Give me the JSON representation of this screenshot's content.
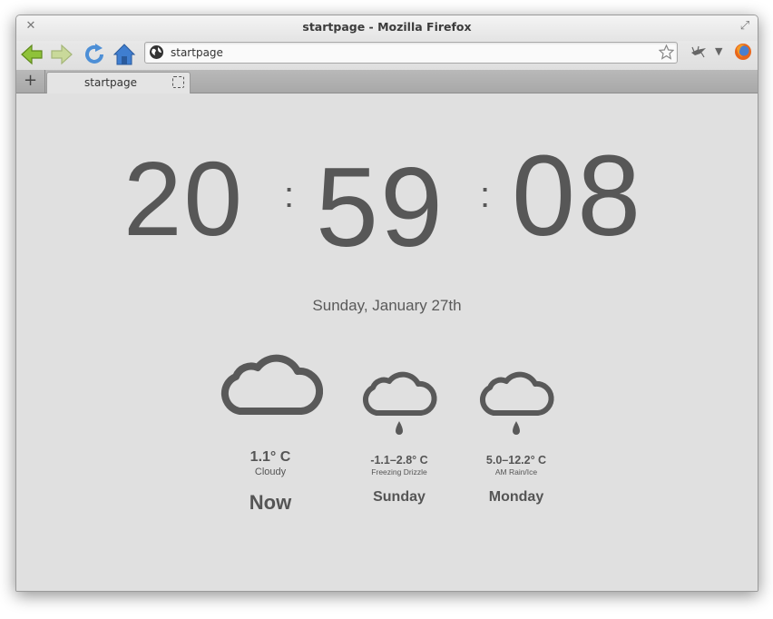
{
  "window": {
    "title": "startpage - Mozilla Firefox"
  },
  "navbar": {
    "url": "startpage"
  },
  "tabs": [
    {
      "label": "startpage"
    }
  ],
  "clock": {
    "hours": "20",
    "minutes": "59",
    "seconds": "08",
    "separator": ":"
  },
  "date": "Sunday, January 27th",
  "forecast": [
    {
      "temp": "1.1° C",
      "condition": "Cloudy",
      "day": "Now",
      "icon": "cloud-icon"
    },
    {
      "temp": "-1.1–2.8° C",
      "condition": "Freezing Drizzle",
      "day": "Sunday",
      "icon": "cloud-drizzle-icon"
    },
    {
      "temp": "5.0–12.2° C",
      "condition": "AM Rain/Ice",
      "day": "Monday",
      "icon": "cloud-rain-icon"
    }
  ],
  "colors": {
    "text": "#575757",
    "background": "#e0e0e0"
  }
}
